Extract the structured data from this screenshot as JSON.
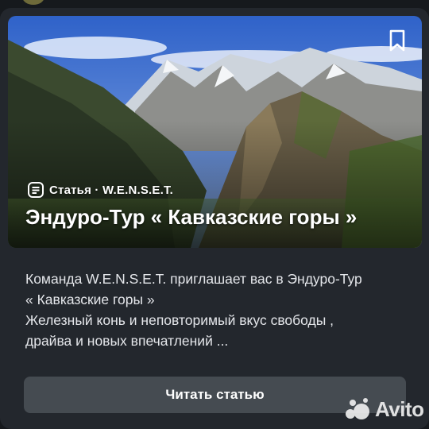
{
  "article": {
    "meta": "Статья · W.E.N.S.E.T.",
    "title": "Эндуро-Тур « Кавказские горы »",
    "excerpt_lines": [
      "Команда W.E.N.S.E.T. приглашает вас в Эндуро-Тур",
      "« Кавказские горы »",
      "Железный конь и неповторимый вкус свободы ,",
      "драйва и новых впечатлений ..."
    ],
    "button_label": "Читать статью"
  },
  "watermark": {
    "text": "Avito"
  },
  "icons": {
    "bookmark": "bookmark-icon",
    "article": "article-icon",
    "logo": "avito-logo-icon"
  },
  "colors": {
    "background": "#16191d",
    "card": "#23272d",
    "button": "#454b51",
    "text": "#ffffff"
  }
}
